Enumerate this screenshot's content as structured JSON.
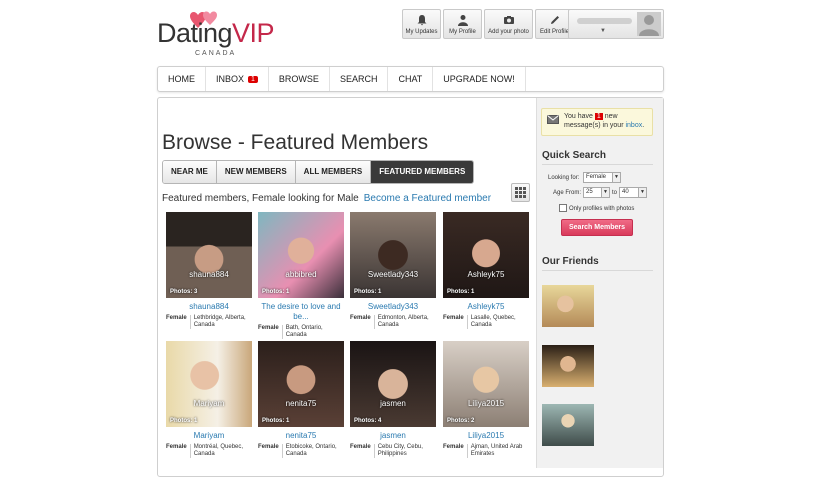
{
  "logo": {
    "word_dark": "Dating",
    "word_brand": "VIP",
    "sub": "CANADA"
  },
  "topnav": [
    {
      "label": "My Updates",
      "icon": "bell-icon"
    },
    {
      "label": "My Profile",
      "icon": "user-icon"
    },
    {
      "label": "Add your photo",
      "icon": "camera-icon"
    },
    {
      "label": "Edit Profile",
      "icon": "pencil-icon"
    }
  ],
  "nav": {
    "items": [
      "HOME",
      "INBOX",
      "BROWSE",
      "SEARCH",
      "CHAT",
      "UPGRADE NOW!"
    ],
    "inbox_badge": "1"
  },
  "page": {
    "title": "Browse - Featured Members",
    "tabs": [
      "NEAR ME",
      "NEW MEMBERS",
      "ALL MEMBERS",
      "FEATURED MEMBERS"
    ],
    "active_tab": "FEATURED MEMBERS",
    "subtitle": "Featured members, Female looking for Male",
    "featured_link": "Become a Featured member"
  },
  "members": [
    {
      "overlay": "shauna884",
      "photos": "Photos: 3",
      "caption": "shauna884",
      "gender": "Female",
      "location": "Lethbridge, Alberta, Canada"
    },
    {
      "overlay": "abbibred",
      "photos": "Photos: 1",
      "caption": "The desire to love and be...",
      "gender": "Female",
      "location": "Bath, Ontario, Canada"
    },
    {
      "overlay": "Sweetlady343",
      "photos": "Photos: 1",
      "caption": "Sweetlady343",
      "gender": "Female",
      "location": "Edmonton, Alberta, Canada"
    },
    {
      "overlay": "Ashleyk75",
      "photos": "Photos: 1",
      "caption": "Ashleyk75",
      "gender": "Female",
      "location": "Lasalle, Quebec, Canada"
    },
    {
      "overlay": "Mariyam",
      "photos": "Photos: 1",
      "caption": "Mariyam",
      "gender": "Female",
      "location": "Montréal, Quebec, Canada"
    },
    {
      "overlay": "nenita75",
      "photos": "Photos: 1",
      "caption": "nenita75",
      "gender": "Female",
      "location": "Etobicoke, Ontario, Canada"
    },
    {
      "overlay": "jasmen",
      "photos": "Photos: 4",
      "caption": "jasmen",
      "gender": "Female",
      "location": "Cebu City, Cebu, Philippines"
    },
    {
      "overlay": "Liliya2015",
      "photos": "Photos: 2",
      "caption": "Liliya2015",
      "gender": "Female",
      "location": "Ajman, United Arab Emirates"
    }
  ],
  "sidebar": {
    "msg_pre": "You have",
    "msg_count": "1",
    "msg_mid": "new message(s) in your",
    "msg_link": "inbox",
    "msg_end": ".",
    "quick_search": "Quick Search",
    "looking_for_label": "Looking for:",
    "looking_for_value": "Female",
    "age_from_label": "Age From:",
    "age_from": "25",
    "age_to_label": "to",
    "age_to": "40",
    "photos_only": "Only profiles with photos",
    "search_button": "Search Members",
    "our_friends": "Our Friends"
  },
  "colors": {
    "brand": "#c4284a",
    "link": "#2a7ab0",
    "button": "#e04866"
  }
}
